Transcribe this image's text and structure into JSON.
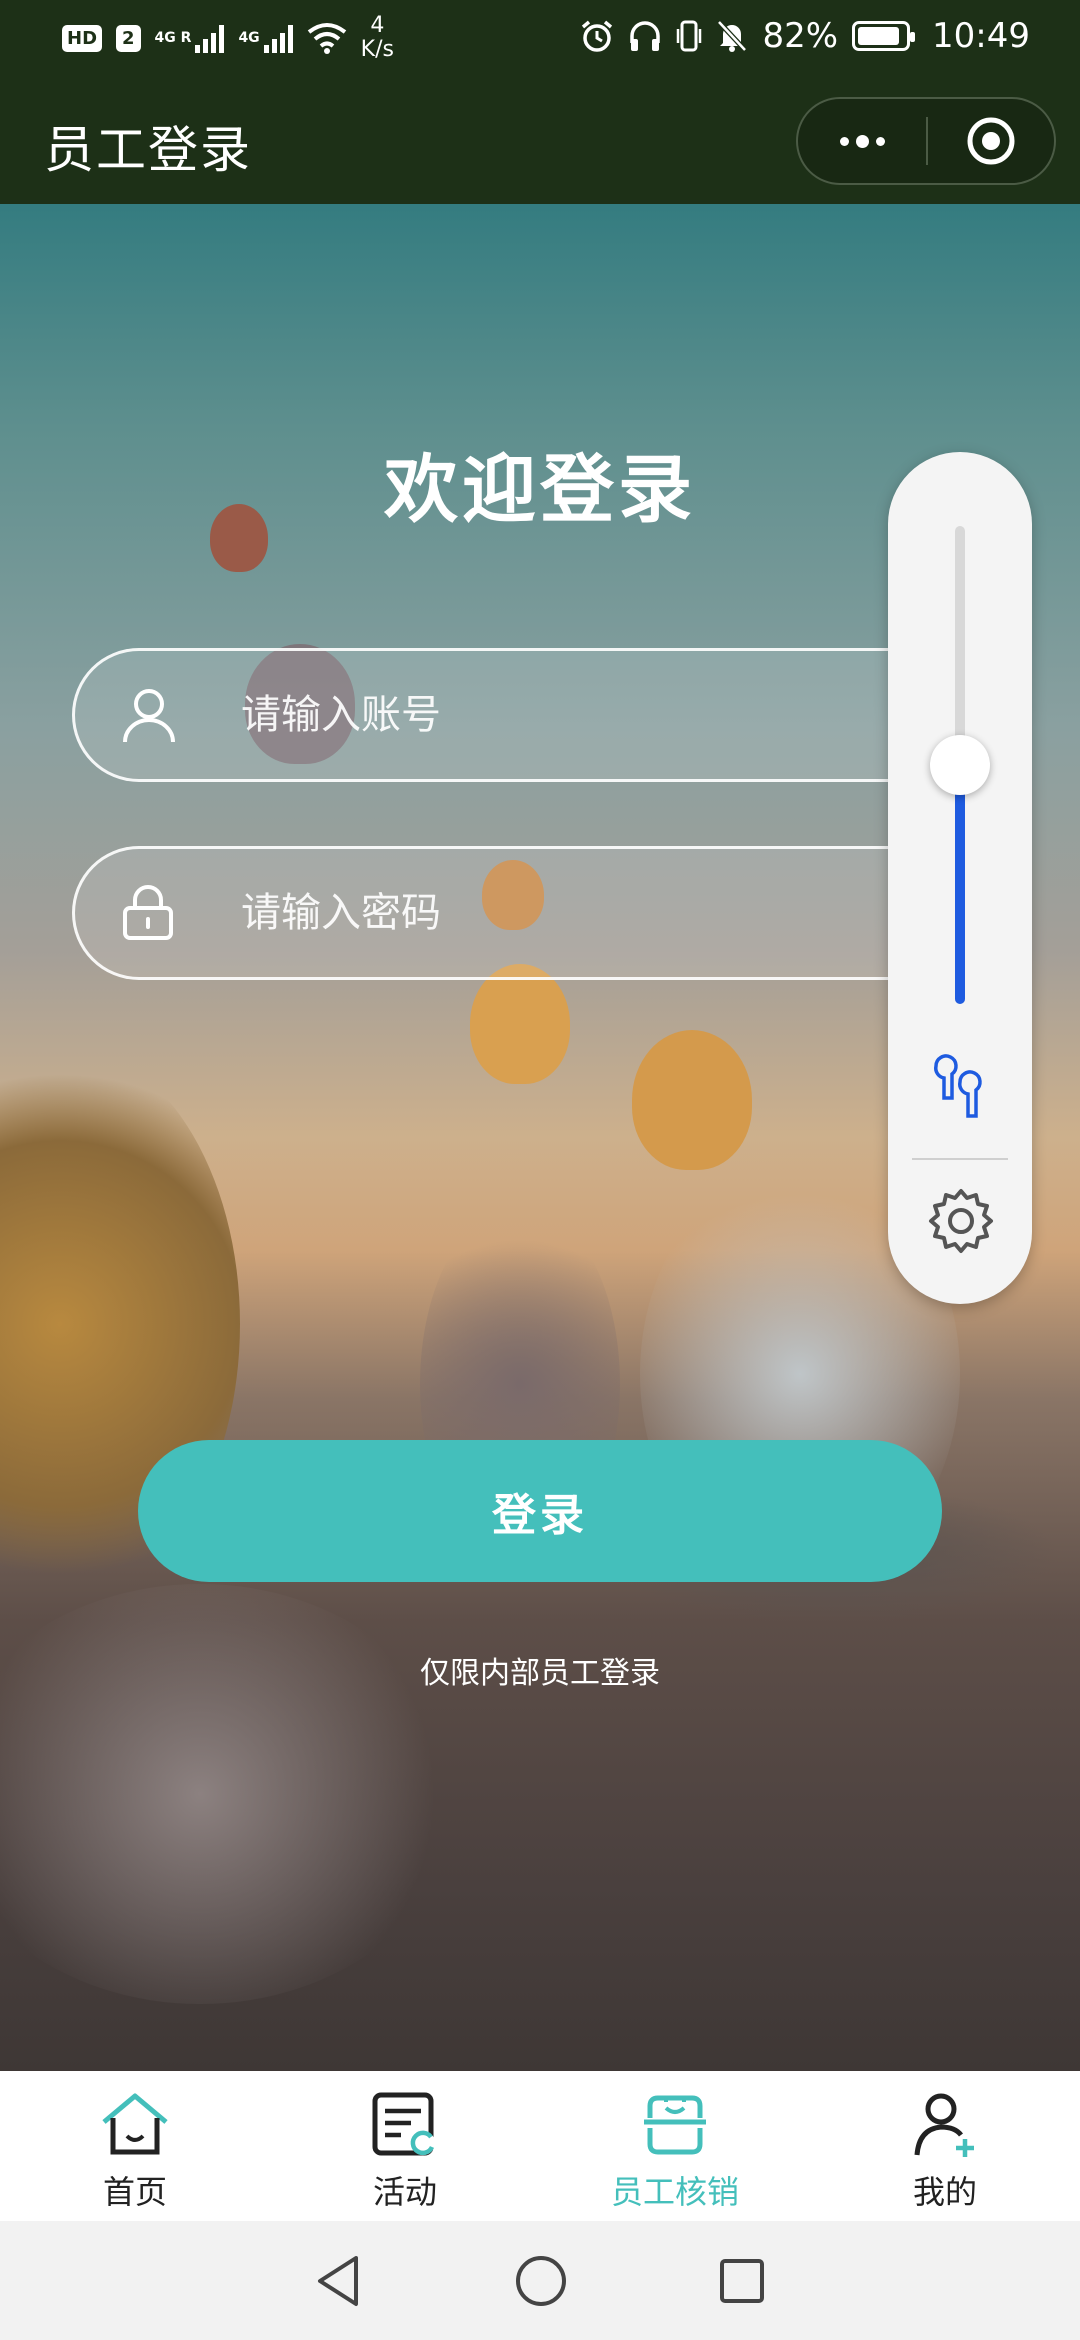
{
  "status_bar": {
    "hd": "HD",
    "sim": "2",
    "net1": "4G R",
    "net2": "4G",
    "speed_value": "4",
    "speed_unit": "K/s",
    "battery": "82%",
    "time": "10:49"
  },
  "header": {
    "title": "员工登录"
  },
  "login": {
    "welcome": "欢迎登录",
    "account_placeholder": "请输入账号",
    "password_placeholder": "请输入密码",
    "button_label": "登录",
    "note": "仅限内部员工登录"
  },
  "volume_panel": {
    "level": 0.5
  },
  "tabbar": {
    "items": [
      {
        "label": "首页",
        "icon": "home-icon"
      },
      {
        "label": "活动",
        "icon": "activity-icon"
      },
      {
        "label": "员工核销",
        "icon": "staff-verify-icon",
        "active": true
      },
      {
        "label": "我的",
        "icon": "profile-add-icon"
      }
    ]
  },
  "colors": {
    "header_bg": "#1d3017",
    "accent": "#44bfbb",
    "volume_fill": "#1e5be0"
  }
}
